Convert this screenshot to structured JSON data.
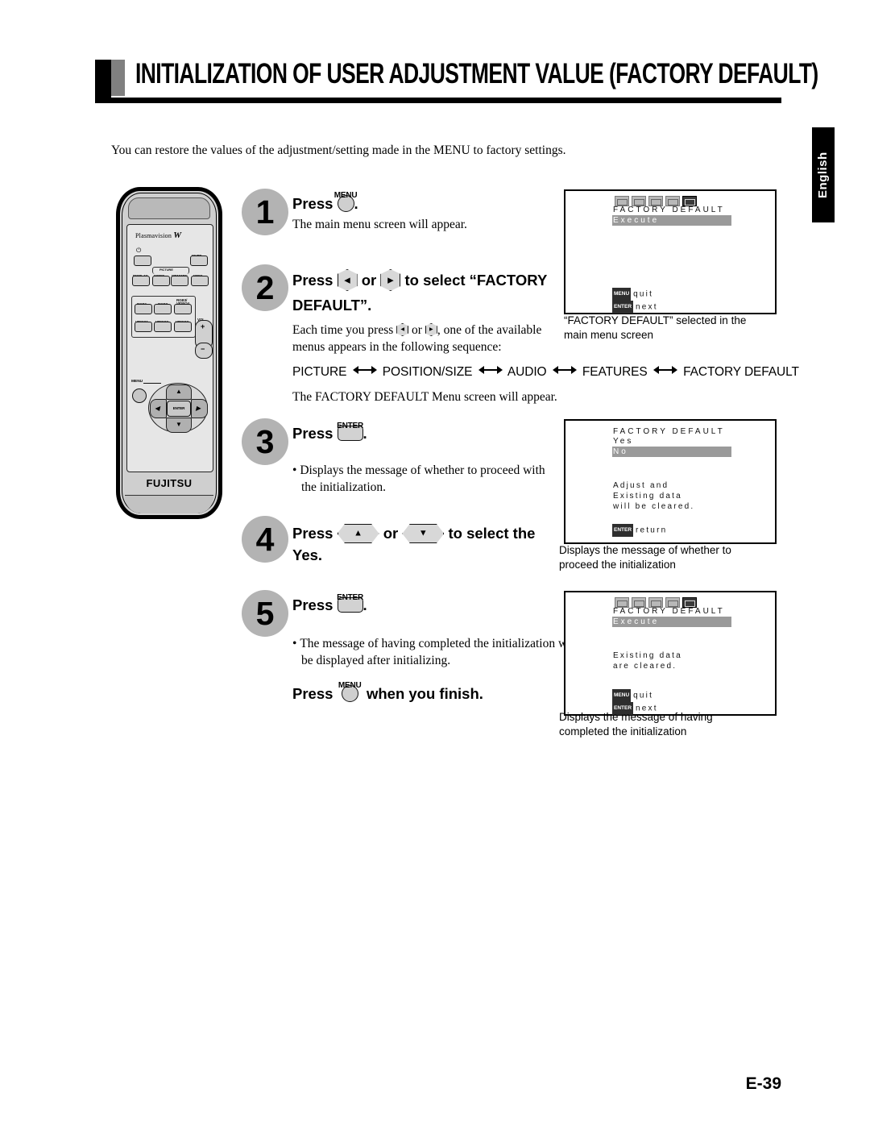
{
  "page": {
    "title": "INITIALIZATION OF USER ADJUSTMENT VALUE (FACTORY DEFAULT)",
    "intro": "You can restore the values of the adjustment/setting made in the MENU to factory settings.",
    "side_tab": "English",
    "page_number": "E-39"
  },
  "remote": {
    "brand_top": "Plasmavision",
    "brand_top_italic": "W",
    "brand_bottom": "FUJITSU",
    "power_glyph": "⏻",
    "labels": {
      "mute": "MUTE",
      "display": "DISPLAY",
      "picture_group": "PICTURE",
      "mode": "MODE",
      "memory": "MEMORY",
      "wide": "WIDE",
      "rgb1": "RGB1",
      "rgb2": "RGB2",
      "rgb3_video4": "RGB3/\nVIDEO4",
      "video1": "VIDEO1",
      "video2": "VIDEO2",
      "video3": "VIDEO3",
      "vol": "VOL",
      "vol_plus": "+",
      "vol_minus": "−",
      "menu": "MENU",
      "enter": "ENTER"
    }
  },
  "steps": [
    {
      "number": "1",
      "headline_before": "Press",
      "key": "MENU",
      "key_type": "round",
      "headline_after": ".",
      "sub": "The main menu screen will appear."
    },
    {
      "number": "2",
      "headline_before": "Press",
      "headline_mid": "or",
      "headline_after": "to select “FACTORY DEFAULT”.",
      "sub": "Each time you press",
      "sub_mid": "or",
      "sub_after": ", one of the available menus appears in the following sequence:"
    },
    {
      "number": "3",
      "headline_before": "Press",
      "key": "ENTER",
      "key_type": "enter",
      "headline_after": ".",
      "sub": "Displays the message of whether to proceed with the initialization."
    },
    {
      "number": "4",
      "headline_before": "Press",
      "headline_mid": "or",
      "headline_after": "to select the Yes."
    },
    {
      "number": "5",
      "headline_before": "Press",
      "key": "ENTER",
      "key_type": "enter",
      "headline_after": ".",
      "sub": "The message of having completed the initialization will be displayed after initializing."
    }
  ],
  "menu_sequence": [
    "PICTURE",
    "POSITION/SIZE",
    "AUDIO",
    "FEATURES",
    "FACTORY DEFAULT"
  ],
  "factory_menu_note": "The FACTORY DEFAULT Menu screen will appear.",
  "finish_line": {
    "before": "Press",
    "key": "MENU",
    "after": "when you finish."
  },
  "osd_screens": [
    {
      "id": "osd-main-menu",
      "has_iconbar": true,
      "icon_count": 5,
      "active_icon_index": 4,
      "title": "FACTORY DEFAULT",
      "highlight": "Execute",
      "message": "",
      "footer": [
        {
          "chip": "MENU",
          "text": "quit"
        },
        {
          "chip": "ENTER",
          "text": "next"
        }
      ],
      "caption": "“FACTORY DEFAULT” selected in the\nmain menu screen"
    },
    {
      "id": "osd-confirm",
      "has_iconbar": false,
      "title": "FACTORY DEFAULT",
      "option": "Yes",
      "highlight": "No",
      "message": "Adjust and\nExisting data\nwill be cleared.",
      "footer": [
        {
          "chip": "ENTER",
          "text": "return"
        }
      ],
      "caption": "Displays the message of whether to\nproceed the initialization"
    },
    {
      "id": "osd-complete",
      "has_iconbar": true,
      "icon_count": 5,
      "active_icon_index": 4,
      "title": "FACTORY DEFAULT",
      "highlight": "Execute",
      "message": "Existing data\nare cleared.",
      "footer": [
        {
          "chip": "MENU",
          "text": "quit"
        },
        {
          "chip": "ENTER",
          "text": "next"
        }
      ],
      "caption": "Displays the message of having\ncompleted the initialization"
    }
  ]
}
